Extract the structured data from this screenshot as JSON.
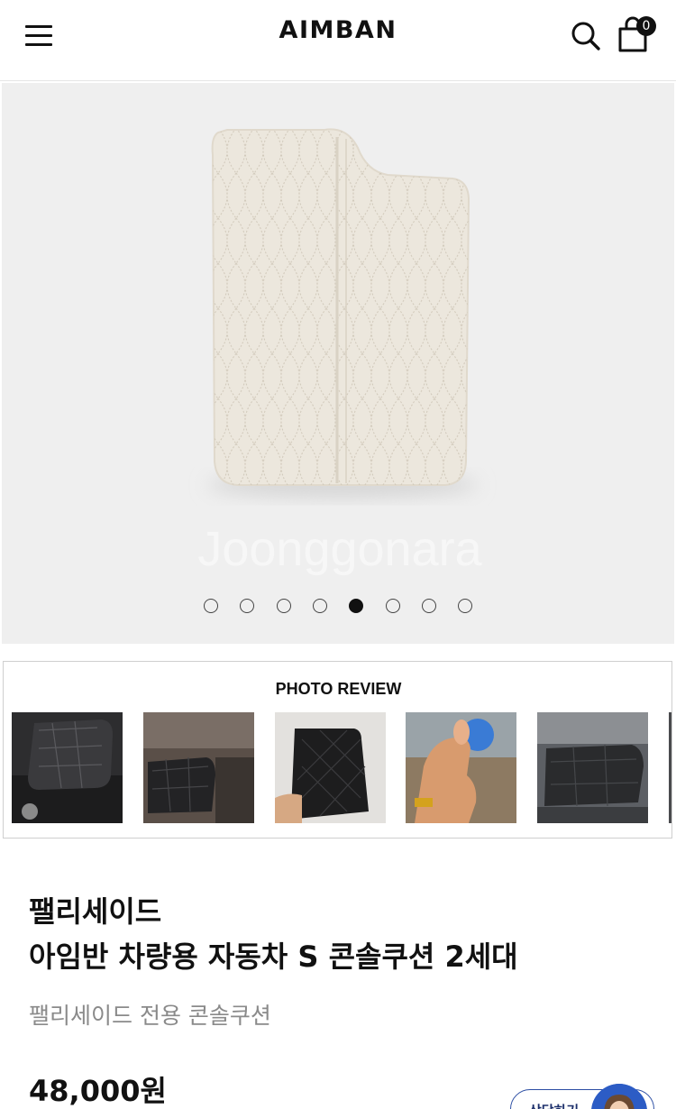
{
  "header": {
    "logo": "AIMBAN",
    "cart_count": "0"
  },
  "gallery": {
    "watermark": "Joonggonara",
    "slide_count": 8,
    "active_index": 4
  },
  "photo_review": {
    "title": "PHOTO REVIEW",
    "thumb_count": 5
  },
  "product": {
    "title_line1": "팰리세이드",
    "title_line2": "아임반 차량용 자동차 S 콘솔쿠션 2세대",
    "subtitle": "팰리세이드 전용 콘솔쿠션",
    "price": "48,000원"
  },
  "cs_button": {
    "label": "상담하기"
  },
  "colors": {
    "accent_blue": "#2c5cc5",
    "text_dark": "#111111",
    "text_muted": "#8a8a8a",
    "cushion": "#ece7dd"
  }
}
